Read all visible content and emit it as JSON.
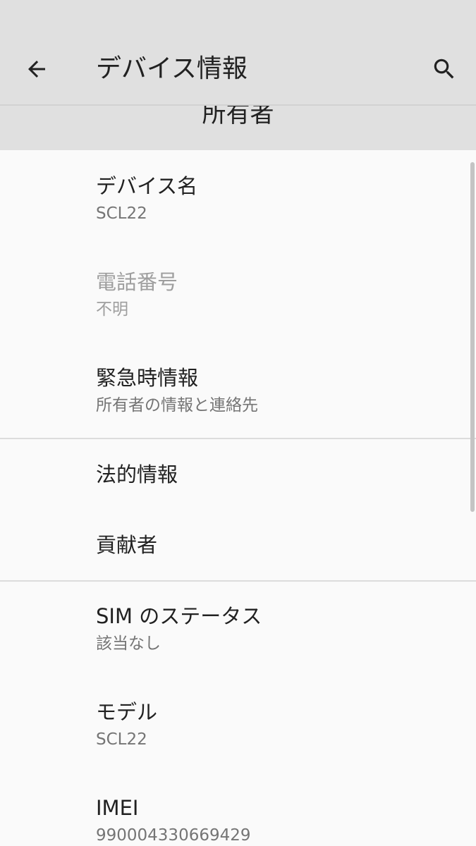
{
  "header": {
    "title": "デバイス情報",
    "back_icon": "arrow-back-icon",
    "search_icon": "search-icon",
    "background": "#e0e0e0"
  },
  "owner_banner": {
    "title": "所有者"
  },
  "items": [
    {
      "title": "デバイス名",
      "summary": "SCL22"
    },
    {
      "title": "電話番号",
      "summary": "不明"
    },
    {
      "title": "緊急時情報",
      "summary": "所有者の情報と連絡先"
    },
    {
      "title": "法的情報"
    },
    {
      "title": "貢献者"
    },
    {
      "title": "SIM のステータス",
      "summary": "該当なし"
    },
    {
      "title": "モデル",
      "summary": "SCL22"
    },
    {
      "title": "IMEI",
      "summary": "990004330669429"
    }
  ]
}
